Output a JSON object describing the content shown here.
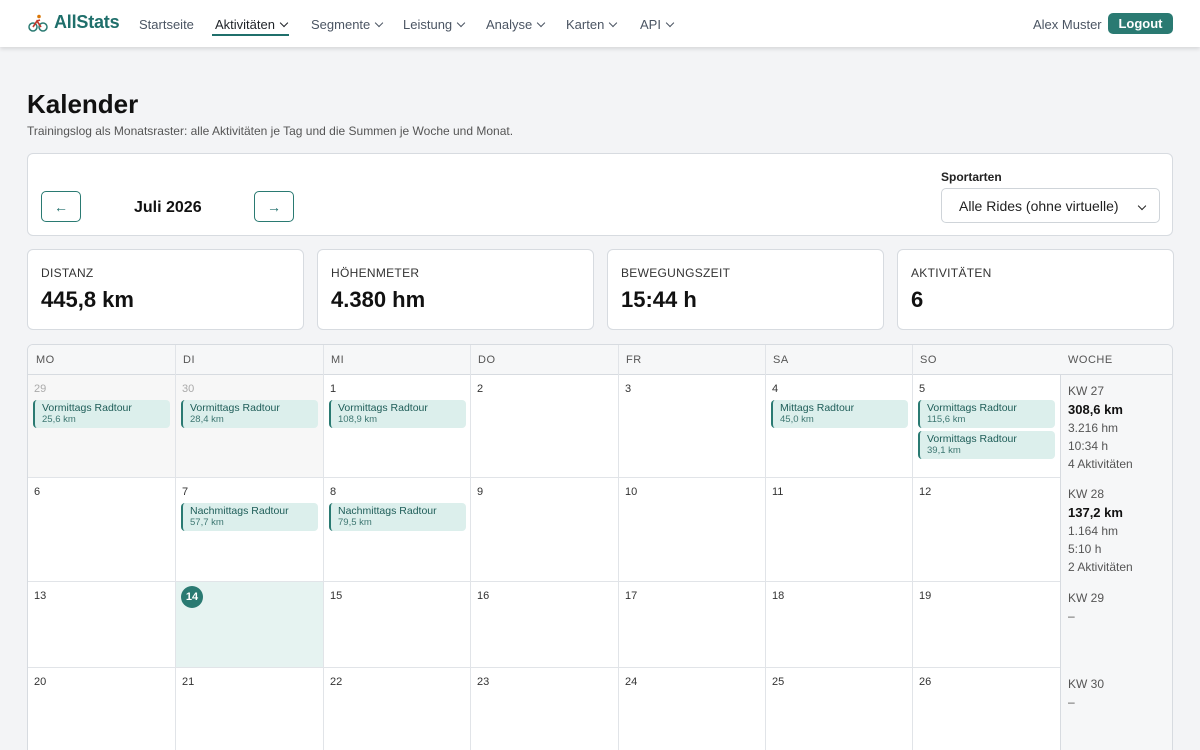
{
  "app": {
    "name": "AllStats"
  },
  "nav": {
    "items": [
      {
        "label": "Startseite"
      },
      {
        "label": "Aktivitäten"
      },
      {
        "label": "Segmente"
      },
      {
        "label": "Leistung"
      },
      {
        "label": "Analyse"
      },
      {
        "label": "Karten"
      },
      {
        "label": "API"
      }
    ],
    "user": "Alex Muster",
    "logout": "Logout"
  },
  "page": {
    "title": "Kalender",
    "subtitle": "Trainingslog als Monatsraster: alle Aktivitäten je Tag und die Summen je Woche und Monat."
  },
  "controls": {
    "prev": "←",
    "next": "→",
    "month": "Juli 2026",
    "sport_label": "Sportarten",
    "sport_value": "Alle Rides (ohne virtuelle)"
  },
  "stats": [
    {
      "label": "DISTANZ",
      "value": "445,8 km"
    },
    {
      "label": "HÖHENMETER",
      "value": "4.380 hm"
    },
    {
      "label": "BEWEGUNGSZEIT",
      "value": "15:44 h"
    },
    {
      "label": "AKTIVITÄTEN",
      "value": "6"
    }
  ],
  "calendar": {
    "headers": [
      "MO",
      "DI",
      "MI",
      "DO",
      "FR",
      "SA",
      "SO",
      "WOCHE"
    ],
    "weeks": [
      {
        "days": [
          {
            "num": "29",
            "outside": true,
            "acts": [
              {
                "name": "Vormittags Radtour",
                "dist": "25,6 km"
              }
            ]
          },
          {
            "num": "30",
            "outside": true,
            "acts": [
              {
                "name": "Vormittags Radtour",
                "dist": "28,4 km"
              }
            ]
          },
          {
            "num": "1",
            "acts": [
              {
                "name": "Vormittags Radtour",
                "dist": "108,9 km"
              }
            ]
          },
          {
            "num": "2",
            "acts": []
          },
          {
            "num": "3",
            "acts": []
          },
          {
            "num": "4",
            "acts": [
              {
                "name": "Mittags Radtour",
                "dist": "45,0 km"
              }
            ]
          },
          {
            "num": "5",
            "acts": [
              {
                "name": "Vormittags Radtour",
                "dist": "115,6 km"
              },
              {
                "name": "Vormittags Radtour",
                "dist": "39,1 km"
              }
            ]
          }
        ],
        "summary": {
          "kw": "KW 27",
          "dist": "308,6 km",
          "hm": "3.216 hm",
          "time": "10:34 h",
          "count": "4 Aktivitäten"
        }
      },
      {
        "days": [
          {
            "num": "6",
            "acts": []
          },
          {
            "num": "7",
            "acts": [
              {
                "name": "Nachmittags Radtour",
                "dist": "57,7 km"
              }
            ]
          },
          {
            "num": "8",
            "acts": [
              {
                "name": "Nachmittags Radtour",
                "dist": "79,5 km"
              }
            ]
          },
          {
            "num": "9",
            "acts": []
          },
          {
            "num": "10",
            "acts": []
          },
          {
            "num": "11",
            "acts": []
          },
          {
            "num": "12",
            "acts": []
          }
        ],
        "summary": {
          "kw": "KW 28",
          "dist": "137,2 km",
          "hm": "1.164 hm",
          "time": "5:10 h",
          "count": "2 Aktivitäten"
        }
      },
      {
        "days": [
          {
            "num": "13",
            "acts": []
          },
          {
            "num": "14",
            "today": true,
            "acts": []
          },
          {
            "num": "15",
            "acts": []
          },
          {
            "num": "16",
            "acts": []
          },
          {
            "num": "17",
            "acts": []
          },
          {
            "num": "18",
            "acts": []
          },
          {
            "num": "19",
            "acts": []
          }
        ],
        "summary": {
          "kw": "KW 29",
          "empty": "–"
        }
      },
      {
        "days": [
          {
            "num": "20",
            "acts": []
          },
          {
            "num": "21",
            "acts": []
          },
          {
            "num": "22",
            "acts": []
          },
          {
            "num": "23",
            "acts": []
          },
          {
            "num": "24",
            "acts": []
          },
          {
            "num": "25",
            "acts": []
          },
          {
            "num": "26",
            "acts": []
          }
        ],
        "summary": {
          "kw": "KW 30",
          "empty": "–"
        }
      }
    ]
  },
  "colors": {
    "brand": "#1f6f6b",
    "accent": "#2a7a72",
    "today_bg": "#e6f3f1",
    "event_bg": "#dcefec"
  }
}
